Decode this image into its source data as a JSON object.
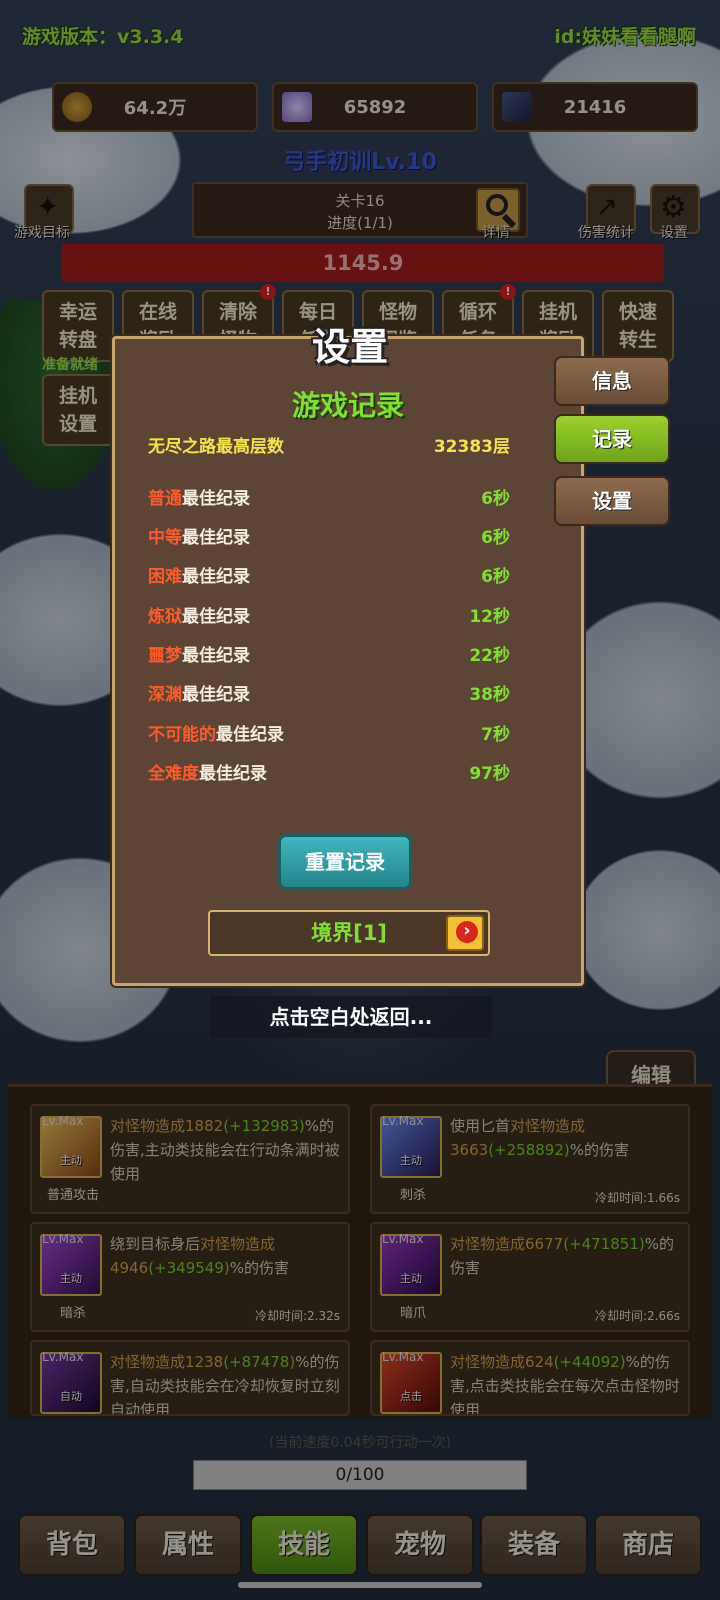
{
  "header": {
    "version": "游戏版本：v3.3.4",
    "user_id": "id:妹妹看看腿啊"
  },
  "resources": {
    "gold": "64.2万",
    "crystal": "65892",
    "cards": "21416"
  },
  "stage": {
    "title": "弓手初训Lv.10",
    "level": "关卡16",
    "progress": "进度(1/1)",
    "details_label": "详情",
    "hp_value": "1145.9"
  },
  "side_buttons": {
    "goal": "游戏目标",
    "damage_stats": "伤害统计",
    "settings": "设置"
  },
  "quick_buttons": [
    {
      "line1": "幸运",
      "line2": "转盘"
    },
    {
      "line1": "在线",
      "line2": "奖励"
    },
    {
      "line1": "清除",
      "line2": "怪物"
    },
    {
      "line1": "每日",
      "line2": "任务"
    },
    {
      "line1": "怪物",
      "line2": "图鉴"
    },
    {
      "line1": "循环",
      "line2": "任务"
    },
    {
      "line1": "挂机",
      "line2": "奖励"
    },
    {
      "line1": "快速",
      "line2": "转生"
    },
    {
      "line1": "挂机",
      "line2": "设置"
    }
  ],
  "ready_text": "准备就绪",
  "modal": {
    "title": "设置",
    "section": "游戏记录",
    "endless": {
      "label": "无尽之路最高层数",
      "value": "32383层"
    },
    "suffix": "最佳纪录",
    "records": [
      {
        "difficulty": "普通",
        "value": "6秒"
      },
      {
        "difficulty": "中等",
        "value": "6秒"
      },
      {
        "difficulty": "困难",
        "value": "6秒"
      },
      {
        "difficulty": "炼狱",
        "value": "12秒"
      },
      {
        "difficulty": "噩梦",
        "value": "22秒"
      },
      {
        "difficulty": "深渊",
        "value": "38秒"
      },
      {
        "difficulty": "不可能的",
        "value": "7秒"
      },
      {
        "difficulty": "全难度",
        "value": "97秒"
      }
    ],
    "reset_label": "重置记录",
    "realm_label": "境界[1]",
    "tabs": [
      "信息",
      "记录",
      "设置"
    ],
    "back_hint": "点击空白处返回..."
  },
  "skills": {
    "edit_label": "编辑",
    "cards": [
      {
        "lv": "Lv.Max",
        "kind": "主动",
        "name": "普通攻击",
        "desc_parts": [
          "对怪物造成1882",
          "(+132983)",
          "%的伤害,主动类技能会在行动条满时被使用"
        ],
        "cd": ""
      },
      {
        "lv": "Lv.Max",
        "kind": "主动",
        "name": "刺杀",
        "desc_parts": [
          "使用匕首",
          "对怪物造成3663",
          "(+258892)",
          "%的伤害"
        ],
        "cd": "冷却时间:1.66s"
      },
      {
        "lv": "Lv.Max",
        "kind": "主动",
        "name": "暗杀",
        "desc_parts": [
          "绕到目标身后",
          "对怪物造成4946",
          "(+349549)",
          "%的伤害"
        ],
        "cd": "冷却时间:2.32s"
      },
      {
        "lv": "Lv.Max",
        "kind": "主动",
        "name": "暗爪",
        "desc_parts": [
          "对怪物造成6677",
          "(+471851)",
          "%的伤害"
        ],
        "cd": "冷却时间:2.66s"
      },
      {
        "lv": "Lv.Max",
        "kind": "自动",
        "name": "",
        "desc_parts": [
          "对怪物造成1238",
          "(+87478)",
          "%的伤害,自动类技能会在冷却恢复时立刻自动使用"
        ],
        "cd": ""
      },
      {
        "lv": "Lv.Max",
        "kind": "点击",
        "name": "",
        "desc_parts": [
          "对怪物造成624",
          "(+44092)",
          "%的伤害,点击类技能会在每次点击怪物时使用"
        ],
        "cd": ""
      }
    ],
    "speed_text": "(当前速度0.04秒可行动一次)",
    "progress_text": "0/100"
  },
  "nav": [
    "背包",
    "属性",
    "技能",
    "宠物",
    "装备",
    "商店"
  ]
}
